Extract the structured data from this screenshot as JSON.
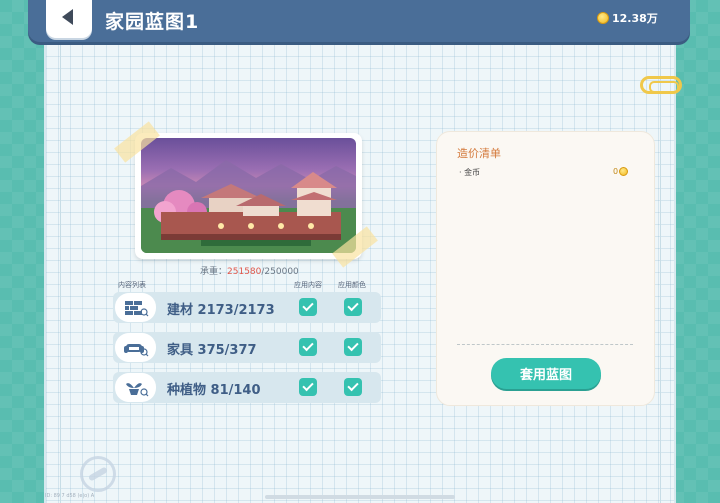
{
  "header": {
    "title": "家园蓝图1",
    "coins": "12.38万"
  },
  "blueprint": {
    "capacity_label": "承重：",
    "capacity_used": "251580",
    "capacity_sep": "/",
    "capacity_max": "250000"
  },
  "list": {
    "header_items": "内容列表",
    "header_apply_content": "应用内容",
    "header_apply_color": "应用颜色",
    "rows": [
      {
        "label": "建材 2173/2173",
        "icon": "building-material-icon",
        "apply_content": true,
        "apply_color": true
      },
      {
        "label": "家具 375/377",
        "icon": "furniture-icon",
        "apply_content": true,
        "apply_color": true
      },
      {
        "label": "种植物 81/140",
        "icon": "plant-icon",
        "apply_content": true,
        "apply_color": true
      }
    ]
  },
  "cost": {
    "title": "造价清单",
    "items": [
      {
        "name": "· 金币",
        "value": "0"
      }
    ],
    "apply_button": "套用蓝图"
  },
  "footer": {
    "uid": "ID: 89 7 d58 (e|o) A"
  },
  "colors": {
    "header": "#4a6e98",
    "accent": "#35c2b0",
    "over_capacity": "#e0564a",
    "cost_title": "#d47a3c"
  }
}
